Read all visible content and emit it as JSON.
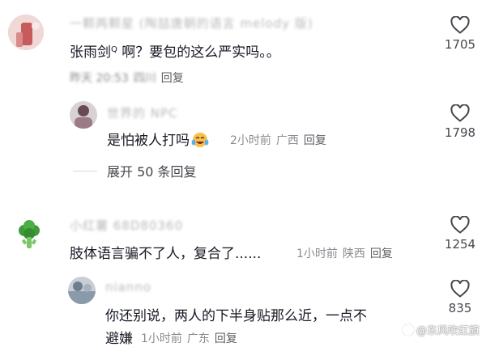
{
  "comments": [
    {
      "name": "一颗两颗星 (陶喆唐朝的语言 melody 版)",
      "text": "张雨剑",
      "text_rest": " 啊？要包的这么严实吗。。",
      "meta_time": "昨天 20:53",
      "meta_location": "四川",
      "reply": "回复",
      "likes": "1705"
    },
    {
      "name": "世界的 NPC",
      "text": "是怕被人打吗",
      "meta_time": "2小时前",
      "meta_location": "广西",
      "reply": "回复",
      "likes": "1798"
    },
    {
      "name": "小红薯 68D80360",
      "text": "肢体语言骗不了人，复合了......",
      "meta_time": "1小时前",
      "meta_location": "陕西",
      "reply": "回复",
      "likes": "1254"
    },
    {
      "name": "nianno",
      "text": "你还别说，两人的下半身贴那么近，一点不",
      "text_line2": "避嫌",
      "meta_time": "1小时前",
      "meta_location": "广东",
      "reply": "回复",
      "likes": "835"
    }
  ],
  "expand_label": "展开 50 条回复",
  "watermark": "@东风吹红旗",
  "icons": {
    "like": "heart-outline-icon",
    "mention": "search-mention-icon",
    "emoji": "crying-laughing-emoji-icon",
    "broccoli": "broccoli-avatar-icon"
  }
}
